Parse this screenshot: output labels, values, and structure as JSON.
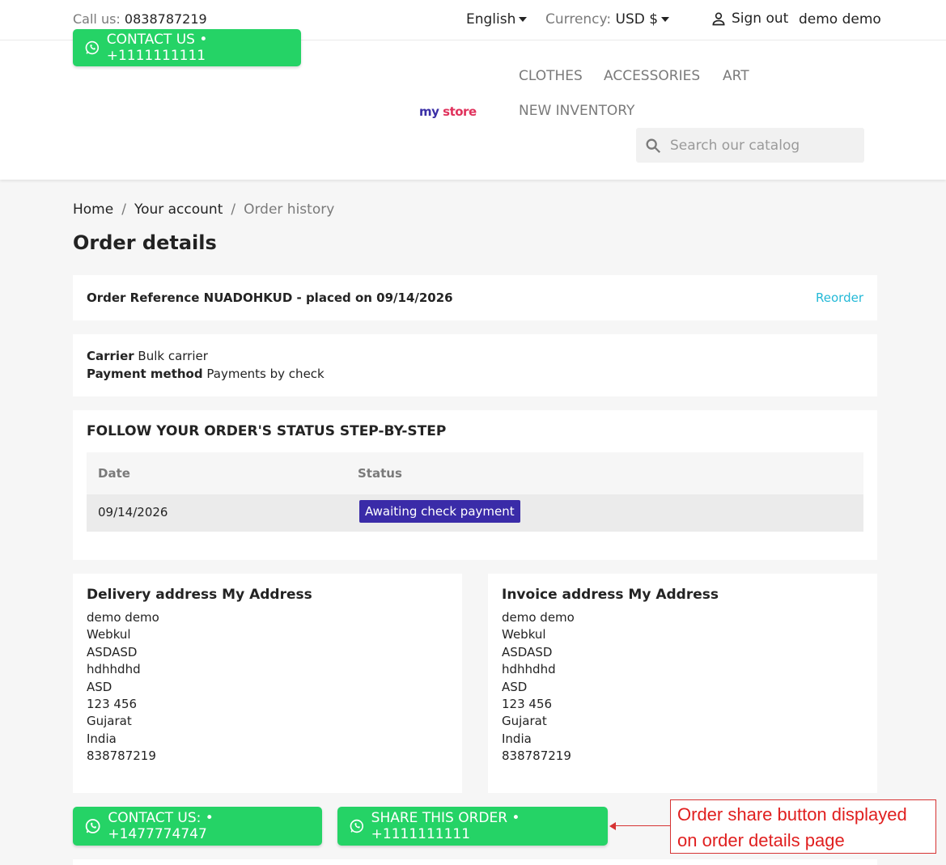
{
  "header": {
    "call_label": "Call us:",
    "call_number": "0838787219",
    "language": "English",
    "currency_label": "Currency:",
    "currency_value": "USD $",
    "signout": "Sign out",
    "username": "demo demo",
    "contact_top": "CONTACT US • +1111111111",
    "logo_my": "my",
    "logo_store": "store",
    "nav": [
      "CLOTHES",
      "ACCESSORIES",
      "ART",
      "NEW INVENTORY"
    ],
    "search_placeholder": "Search our catalog"
  },
  "breadcrumb": [
    "Home",
    "Your account",
    "Order history"
  ],
  "page_title": "Order details",
  "order": {
    "reference_text": "Order Reference NUADOHKUD - placed on 09/14/2026",
    "reorder": "Reorder",
    "carrier_label": "Carrier",
    "carrier_value": "Bulk carrier",
    "payment_label": "Payment method",
    "payment_value": "Payments by check"
  },
  "status_section": {
    "title": "FOLLOW YOUR ORDER'S STATUS STEP-BY-STEP",
    "col_date": "Date",
    "col_status": "Status",
    "rows": [
      {
        "date": "09/14/2026",
        "status": "Awaiting check payment"
      }
    ],
    "badge_color": "#3a2ba8"
  },
  "delivery": {
    "title": "Delivery address My Address",
    "lines": [
      "demo demo",
      "Webkul",
      "ASDASD",
      "hdhhdhd",
      "ASD",
      "123 456",
      "Gujarat",
      "India",
      "838787219"
    ]
  },
  "invoice": {
    "title": "Invoice address My Address",
    "lines": [
      "demo demo",
      "Webkul",
      "ASDASD",
      "hdhhdhd",
      "ASD",
      "123 456",
      "Gujarat",
      "India",
      "838787219"
    ]
  },
  "actions": {
    "contact": "CONTACT US: • +1477774747",
    "share": "SHARE THIS ORDER • +1111111111"
  },
  "annotation": "Order share button displayed on order details page",
  "colors": {
    "whatsapp": "#25d366",
    "link": "#24b9d7",
    "annotation": "#e01f1f"
  }
}
